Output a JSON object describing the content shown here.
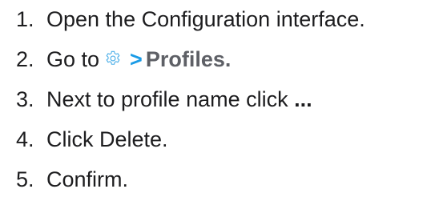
{
  "steps": [
    {
      "number": "1.",
      "text": "Open the Configuration interface."
    },
    {
      "number": "2.",
      "text_before": "Go to",
      "icon": "gear-icon",
      "separator": ">",
      "target": "Profiles."
    },
    {
      "number": "3.",
      "text": "Next to profile name click",
      "emphasis": "..."
    },
    {
      "number": "4.",
      "text": "Click Delete."
    },
    {
      "number": "5.",
      "text": "Confirm."
    }
  ],
  "colors": {
    "text": "#1d1d1f",
    "accent": "#1a9be6",
    "menu_path": "#5e6066",
    "icon_stroke": "#4aaee8"
  }
}
